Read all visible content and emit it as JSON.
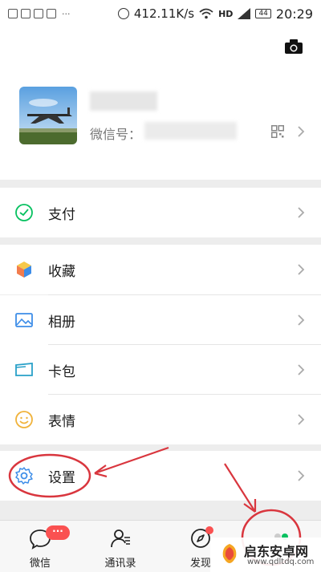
{
  "status_bar": {
    "net_speed": "412.11K/s",
    "network": "HD",
    "battery": "44",
    "time": "20:29",
    "overflow": "···"
  },
  "profile": {
    "wxid_label": "微信号：",
    "icons": [
      "camera-icon",
      "qr-code-icon",
      "chevron-right-icon"
    ]
  },
  "menu": {
    "pay": "支付",
    "favorites": "收藏",
    "album": "相册",
    "cards": "卡包",
    "stickers": "表情",
    "settings": "设置"
  },
  "tabbar": {
    "chats": "微信",
    "chats_badge": "···",
    "contacts": "通讯录",
    "discover": "发现"
  },
  "watermark": {
    "title": "启东安卓网",
    "url": "www.qdltdq.com"
  },
  "colors": {
    "wechat_green": "#07c160",
    "badge_red": "#fa5151",
    "annotation_red": "#d9363e",
    "background": "#ededed"
  }
}
